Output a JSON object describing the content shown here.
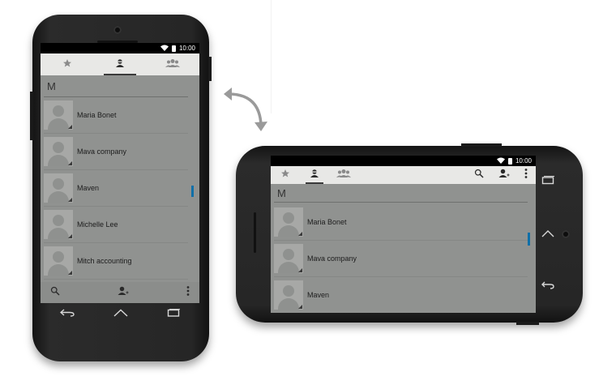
{
  "status": {
    "time": "10:00"
  },
  "colors": {
    "scroll_indicator": "#0f6fa8",
    "screen_bg": "#909290",
    "tabbar_bg": "#e8e8e6"
  },
  "tabs": [
    {
      "icon": "star-icon",
      "active": false
    },
    {
      "icon": "person-icon",
      "active": true
    },
    {
      "icon": "group-icon",
      "active": false
    }
  ],
  "section": {
    "letter": "M"
  },
  "contacts_portrait": [
    {
      "name": "Maria Bonet"
    },
    {
      "name": "Mava company"
    },
    {
      "name": "Maven"
    },
    {
      "name": "Michelle Lee"
    },
    {
      "name": "Mitch accounting"
    }
  ],
  "contacts_landscape": [
    {
      "name": "Maria Bonet"
    },
    {
      "name": "Mava company"
    },
    {
      "name": "Maven"
    }
  ],
  "actions": [
    "search-icon",
    "add-contact-icon",
    "overflow-menu-icon"
  ],
  "nav": [
    "back-icon",
    "home-icon",
    "recents-icon"
  ]
}
